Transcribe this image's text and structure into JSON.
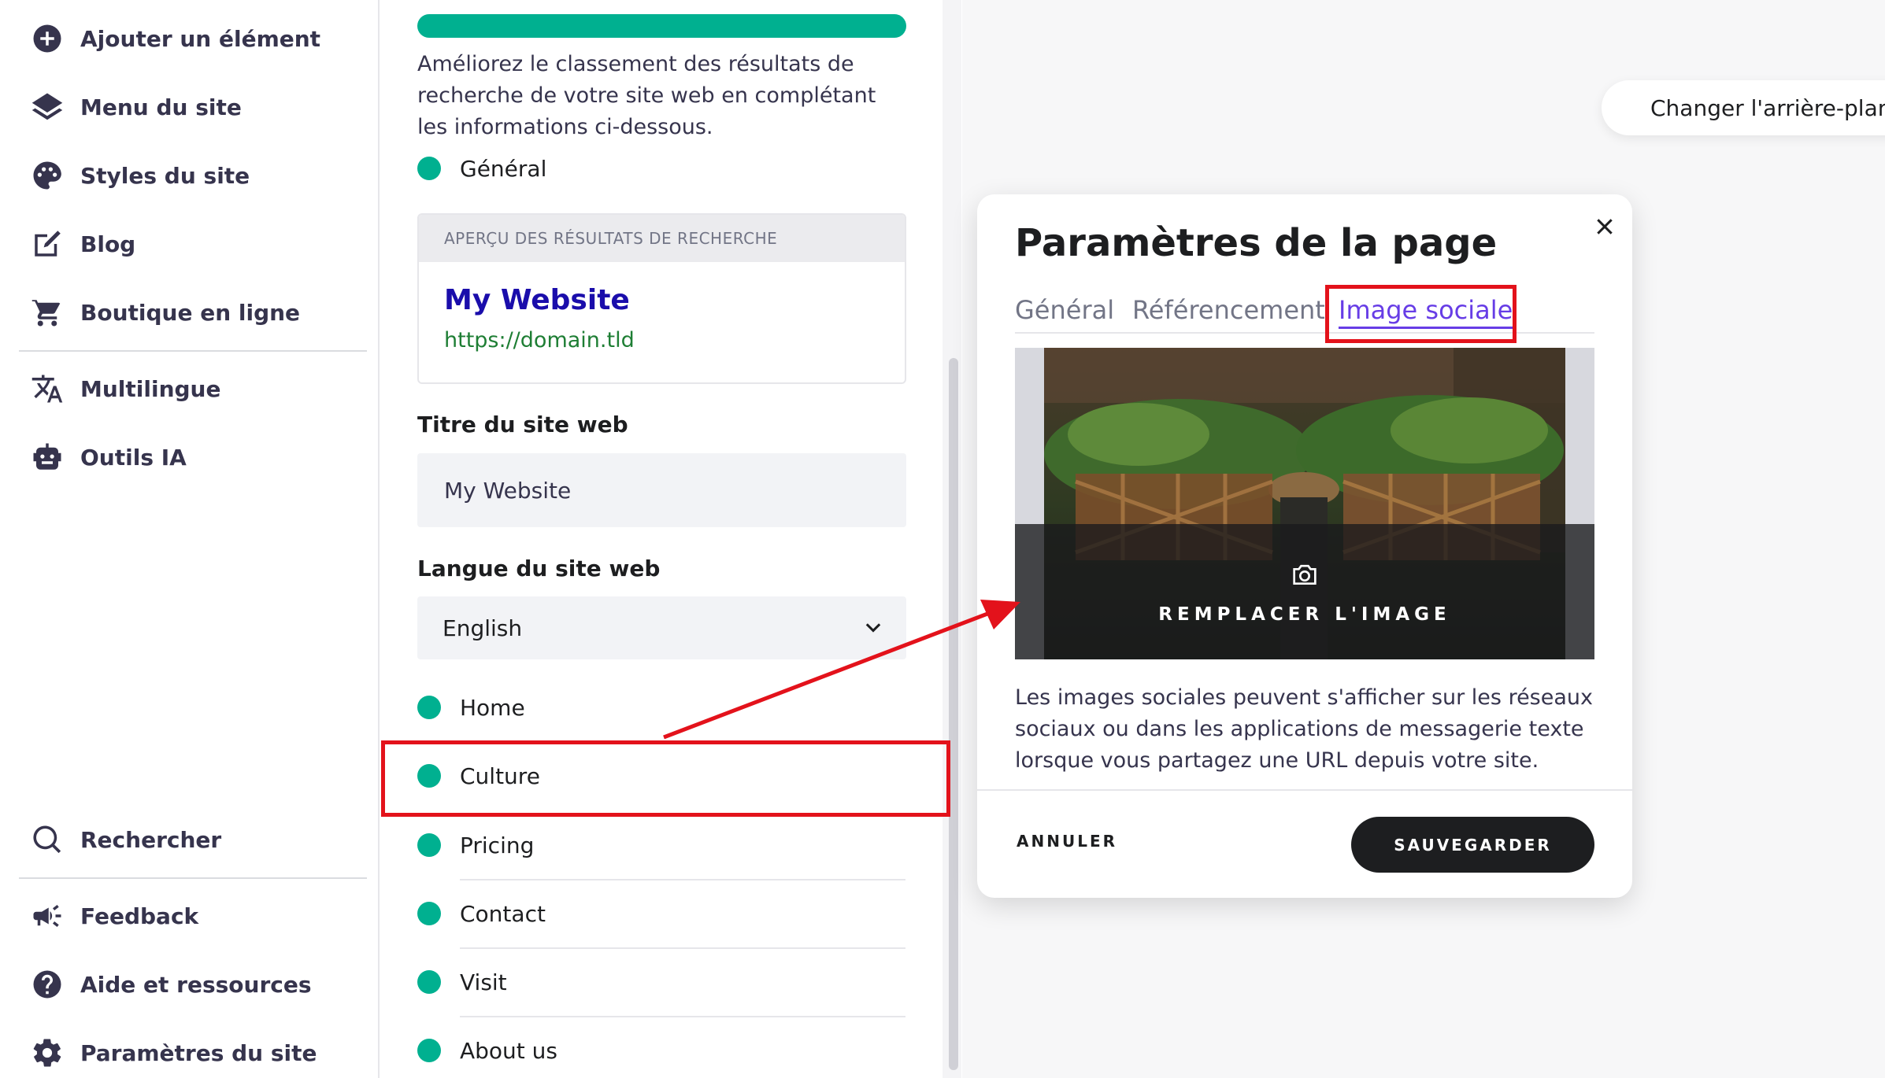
{
  "sidebar": {
    "top_items": [
      {
        "label": "Ajouter un élément",
        "icon": "add-circle-icon"
      },
      {
        "label": "Menu du site",
        "icon": "layers-icon"
      },
      {
        "label": "Styles du site",
        "icon": "palette-icon"
      },
      {
        "label": "Blog",
        "icon": "edit-icon"
      },
      {
        "label": "Boutique en ligne",
        "icon": "cart-icon"
      }
    ],
    "middle_items": [
      {
        "label": "Multilingue",
        "icon": "translate-icon"
      },
      {
        "label": "Outils IA",
        "icon": "robot-icon"
      }
    ],
    "bottom_items": [
      {
        "label": "Rechercher",
        "icon": "search-icon"
      },
      {
        "label": "Feedback",
        "icon": "megaphone-icon"
      },
      {
        "label": "Aide et ressources",
        "icon": "help-icon"
      },
      {
        "label": "Paramètres du site",
        "icon": "gear-icon"
      }
    ]
  },
  "settings": {
    "progress_fraction": 1.0,
    "intro": "Améliorez le classement des résultats de recherche de votre site web en complétant les informations ci-dessous.",
    "general_label": "Général",
    "preview": {
      "heading": "APERÇU DES RÉSULTATS DE RECHERCHE",
      "title": "My Website",
      "url": "https://domain.tld"
    },
    "site_title_label": "Titre du site web",
    "site_title_value": "My Website",
    "language_label": "Langue du site web",
    "language_value": "English",
    "pages": [
      "Home",
      "Culture",
      "Pricing",
      "Contact",
      "Visit",
      "About us"
    ],
    "highlighted_page": "Culture"
  },
  "canvas": {
    "change_background": "Changer l'arrière-plan"
  },
  "modal": {
    "title": "Paramètres de la page",
    "tabs": [
      {
        "label": "Général",
        "active": false
      },
      {
        "label": "Référencement",
        "active": false
      },
      {
        "label": "Image sociale",
        "active": true
      }
    ],
    "replace_image": "REMPLACER L'IMAGE",
    "description": "Les images sociales peuvent s'afficher sur les réseaux sociaux ou dans les applications de messagerie texte lorsque vous partagez une URL depuis votre site.",
    "cancel": "ANNULER",
    "save": "SAUVEGARDER"
  },
  "colors": {
    "accent_green": "#00b090",
    "active_tab": "#673de6",
    "annotation_red": "#e3121b",
    "preview_link": "#1a0dab",
    "preview_url": "#1e7e34"
  }
}
